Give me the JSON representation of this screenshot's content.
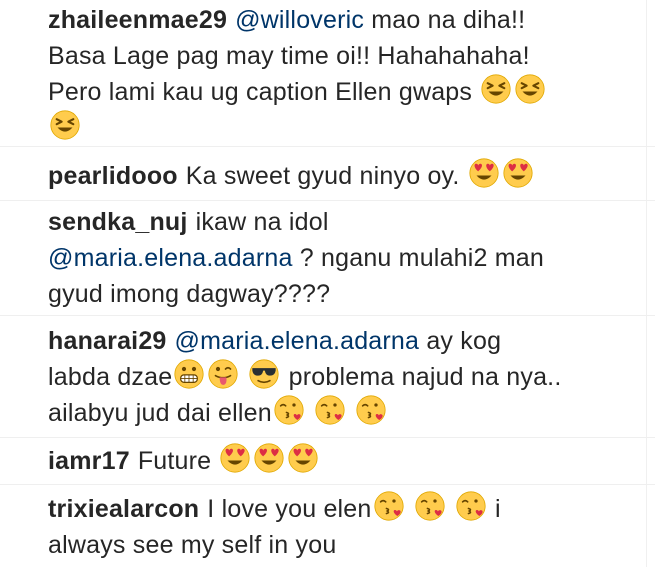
{
  "comments": [
    {
      "username": "zhaileenmae29",
      "mention": "@willoveric",
      "text_part1": "mao na diha!!",
      "text_part2": "Basa Lage pag may time oi!! Hahahahaha!",
      "text_part3": "Pero lami kau ug caption Ellen gwaps",
      "emojis": [
        "squinting-face",
        "squinting-face",
        "squinting-face"
      ]
    },
    {
      "username": "pearlidooo",
      "text": "Ka sweet gyud ninyo oy.",
      "emojis": [
        "heart-eyes",
        "heart-eyes"
      ]
    },
    {
      "username": "sendka_nuj",
      "text_part1": "ikaw na idol",
      "mention": "@maria.elena.adarna",
      "text_part2": "? nganu mulahi2 man",
      "text_part3": "gyud imong dagway????"
    },
    {
      "username": "hanarai29",
      "mention": "@maria.elena.adarna",
      "text_part1": "ay kog",
      "text_part2": "labda dzae",
      "text_part3": "problema najud na nya..",
      "text_part4": "ailabyu jud dai ellen",
      "emojis_line2": [
        "grimace",
        "tongue-wink",
        "sunglasses"
      ],
      "emojis_line3": [
        "kiss-heart",
        "kiss-heart",
        "kiss-heart"
      ]
    },
    {
      "username": "iamr17",
      "text": "Future",
      "emojis": [
        "heart-eyes",
        "heart-eyes",
        "heart-eyes"
      ]
    },
    {
      "username": "trixiealarcon",
      "text_part1": "I love you elen",
      "text_part2": "i",
      "text_part3": "always see my self in you",
      "emojis": [
        "kiss-heart",
        "kiss-heart",
        "kiss-heart"
      ]
    }
  ],
  "colors": {
    "text": "#262626",
    "mention": "#003569",
    "emoji_face": "#FFCC4D",
    "emoji_heart": "#DD2E44"
  }
}
